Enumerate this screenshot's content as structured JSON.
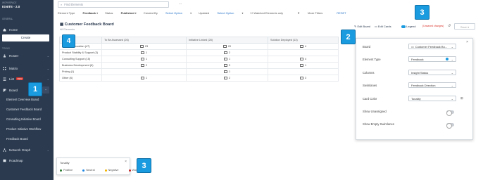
{
  "sidebar": {
    "workspace_label": "WORKSPACE",
    "workspace_name": "IGNITE - 2.0",
    "general_label": "GENERAL",
    "home": "Home",
    "create": "Create",
    "tools_label": "TOOLS",
    "items": [
      {
        "label": "Roster"
      },
      {
        "label": "Matrix"
      },
      {
        "label": "List",
        "badge": "NEW"
      },
      {
        "label": "Board"
      }
    ],
    "board_sub": [
      "Element Overview Board",
      "Customer Feedback Board",
      "Consulting Initiative Board",
      "Product Initiative Workflow",
      "Feedback Board"
    ],
    "network_graph": "Network Graph",
    "roadmap": "Roadmap"
  },
  "search": {
    "placeholder": "Find Elements",
    "ellipsis": "..."
  },
  "filters": {
    "element_type_label": "Element Type",
    "element_type_value": "Feedback",
    "status_label": "Status",
    "status_value": "Published",
    "created_by_label": "Created By",
    "created_by_value": "Select Option",
    "updated_label": "Updated",
    "updated_value": "Select Option",
    "watched": "Watched Elements only",
    "more": "More Filters",
    "reset": "RESET"
  },
  "board": {
    "title": "Customer Feedback Board",
    "subtitle": "All Elements",
    "edit_board": "Edit Board",
    "edit_cards": "Edit Cards",
    "legend": "Legend",
    "unsaved": "(Unsaved changes)",
    "save": "Save",
    "columns": [
      "",
      "To Be Assessed (26)",
      "Initiative Linked (28)",
      "Solution Deployed (13)"
    ],
    "rows": [
      {
        "label": "Product Innovation (47)",
        "c1": "23",
        "c2": "20",
        "c3": "4"
      },
      {
        "label": "Product Stability & Support (3)",
        "c1": "1",
        "c2": "2",
        "c3": ""
      },
      {
        "label": "Consulting Support (15)",
        "c1": "1",
        "c2": "1",
        "c3": "4"
      },
      {
        "label": "Business Development (6)",
        "c1": "2",
        "c2": "3",
        "c3": "1"
      },
      {
        "label": "Pricing (1)",
        "c1": "",
        "c2": "1",
        "c3": ""
      },
      {
        "label": "Other (6)",
        "c1": "1",
        "c2": "2",
        "c3": "3"
      }
    ]
  },
  "settings": {
    "board_label": "Board",
    "board_value": "Customer Feedback Bo...",
    "element_type_label": "Element Type",
    "element_type_value": "Feedback",
    "columns_label": "Columns",
    "columns_value": "Insight Status",
    "swimlanes_label": "Swimlanes",
    "swimlanes_value": "Feedback Direction",
    "card_color_label": "Card Color",
    "card_color_value": "Tonality",
    "show_unassigned": "Show Unassigned",
    "show_empty": "Show Empty Swimlanes"
  },
  "legend_panel": {
    "title": "Tonality",
    "items": [
      {
        "label": "Positive",
        "color": "#2e7d32"
      },
      {
        "label": "Neutral",
        "color": "#1e88e5"
      },
      {
        "label": "Negative",
        "color": "#f4b400"
      },
      {
        "label": "Wondering",
        "color": "#c62828"
      }
    ]
  },
  "callouts": [
    "1",
    "2",
    "3",
    "3",
    "4"
  ]
}
